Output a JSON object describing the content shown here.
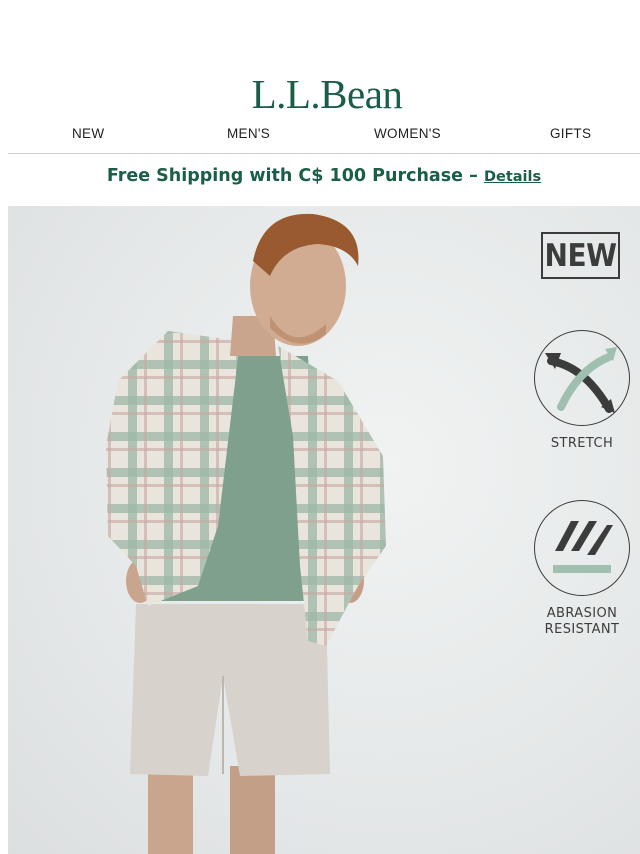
{
  "brand": {
    "logo_text": "L.L.Bean",
    "color": "#1b5e46"
  },
  "nav": {
    "items": [
      {
        "label": "NEW"
      },
      {
        "label": "MEN'S"
      },
      {
        "label": "WOMEN'S"
      },
      {
        "label": "GIFTS"
      }
    ]
  },
  "promo": {
    "text": "Free Shipping with C$ 100 Purchase –",
    "link_label": "Details"
  },
  "hero": {
    "badges": {
      "new": "NEW",
      "stretch": "STRETCH",
      "abrasion_line1": "ABRASION",
      "abrasion_line2": "RESISTANT"
    },
    "colors": {
      "shirt_green": "#7e9e88",
      "tee": "#7fa08d",
      "shorts": "#d6d1cc",
      "accent": "#8fb5a2"
    }
  }
}
